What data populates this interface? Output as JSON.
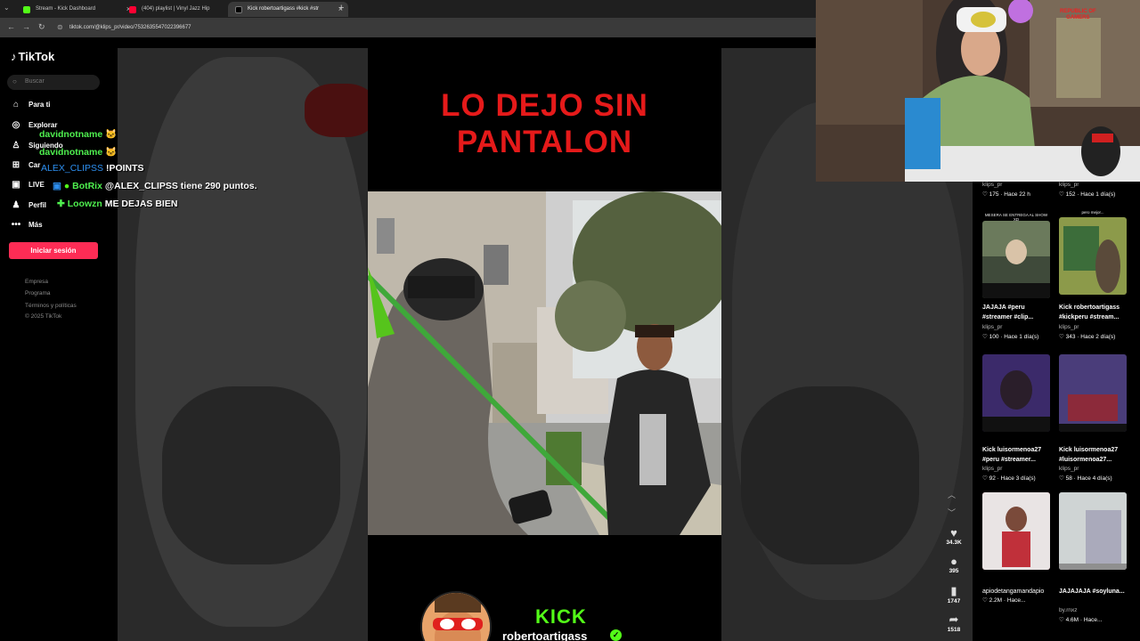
{
  "browser": {
    "tabs": [
      {
        "title": "Stream - Kick Dashboard",
        "icon_color": "#53fc18",
        "active": false
      },
      {
        "title": "(404) playlist | Vinyl Jazz Hip",
        "icon_color": "#ff0033",
        "active": false
      },
      {
        "title": "Kick robertoartigass #kick #str",
        "icon_color": "#ffffff",
        "active": true
      }
    ],
    "url": "tiktok.com/@klips_pr/video/7532635547022396677"
  },
  "sidebar": {
    "brand": "TikTok",
    "search_placeholder": "Buscar",
    "nav": [
      {
        "label": "Para ti",
        "icon": "home-icon"
      },
      {
        "label": "Explorar",
        "icon": "compass-icon"
      },
      {
        "label": "Siguiendo",
        "icon": "person-icon"
      },
      {
        "label": "Car",
        "icon": "upload-icon"
      },
      {
        "label": "LIVE",
        "icon": "live-icon"
      },
      {
        "label": "Perfil",
        "icon": "profile-icon"
      },
      {
        "label": "Más",
        "icon": "more-icon"
      }
    ],
    "login_label": "Iniciar sesión",
    "footer": [
      "Empresa",
      "Programa",
      "Términos y políticas",
      "© 2025 TikTok"
    ]
  },
  "video": {
    "title_line1": "LO DEJO SIN",
    "title_line2": "PANTALON",
    "kick_label": "KICK",
    "channel": "robertoartigass"
  },
  "actions": [
    {
      "name": "like",
      "icon": "heart-icon",
      "count": "34.3K"
    },
    {
      "name": "comment",
      "icon": "comment-icon",
      "count": "395"
    },
    {
      "name": "save",
      "icon": "bookmark-icon",
      "count": "1747"
    },
    {
      "name": "share",
      "icon": "share-icon",
      "count": "1518"
    }
  ],
  "related": {
    "top_meta": [
      {
        "author": "klips_pr",
        "stats": "175 · Hace 22 h"
      },
      {
        "author": "klips_pr",
        "stats": "152 · Hace 1 día(s)"
      }
    ],
    "cards": [
      {
        "caption": "MESERA SE ENTREGA AL SHOW XD",
        "title": "JAJAJA #peru  #streamer #clip...",
        "author": "klips_pr",
        "stats": "100 · Hace 1 día(s)",
        "thumb_color": "#6b7a5c"
      },
      {
        "caption": "pero mejor...",
        "title": "Kick robertoartigass #kickperu #stream...",
        "author": "klips_pr",
        "stats": "343 · Hace 2 día(s)",
        "thumb_color": "#8c9a4a"
      },
      {
        "caption": "",
        "title": "Kick luisormenoa27 #peru  #streamer...",
        "author": "klips_pr",
        "stats": "92 · Hace 3 día(s)",
        "thumb_color": "#3b2a6a"
      },
      {
        "caption": "",
        "title": "Kick luisormenoa27 #luisormenoa27...",
        "author": "klips_pr",
        "stats": "58 · Hace 4 día(s)",
        "thumb_color": "#4a3d7a"
      },
      {
        "caption": "",
        "title": "apiodetangamandapio",
        "author": "",
        "stats": "2.2M · Hace...",
        "thumb_color": "#b04050"
      },
      {
        "caption": "",
        "title": "JAJAJAJA #soyluna...",
        "author": "by.rnxz",
        "stats": "4.6M · Hace...",
        "thumb_color": "#7d8a8a"
      }
    ]
  },
  "chat": [
    {
      "user": "davidnotname",
      "message": ""
    },
    {
      "user": "davidnotname",
      "message": ""
    },
    {
      "user": "ALEX_CLIPSS",
      "message": "!POINTS"
    },
    {
      "user": "BotRix",
      "message": "@ALEX_CLIPSS tiene 290 puntos."
    },
    {
      "user": "Loowzn",
      "message": "ME DEJAS BIEN"
    }
  ],
  "cam": {
    "brand_line1": "REPUBLIC OF",
    "brand_line2": "GAMERS"
  }
}
